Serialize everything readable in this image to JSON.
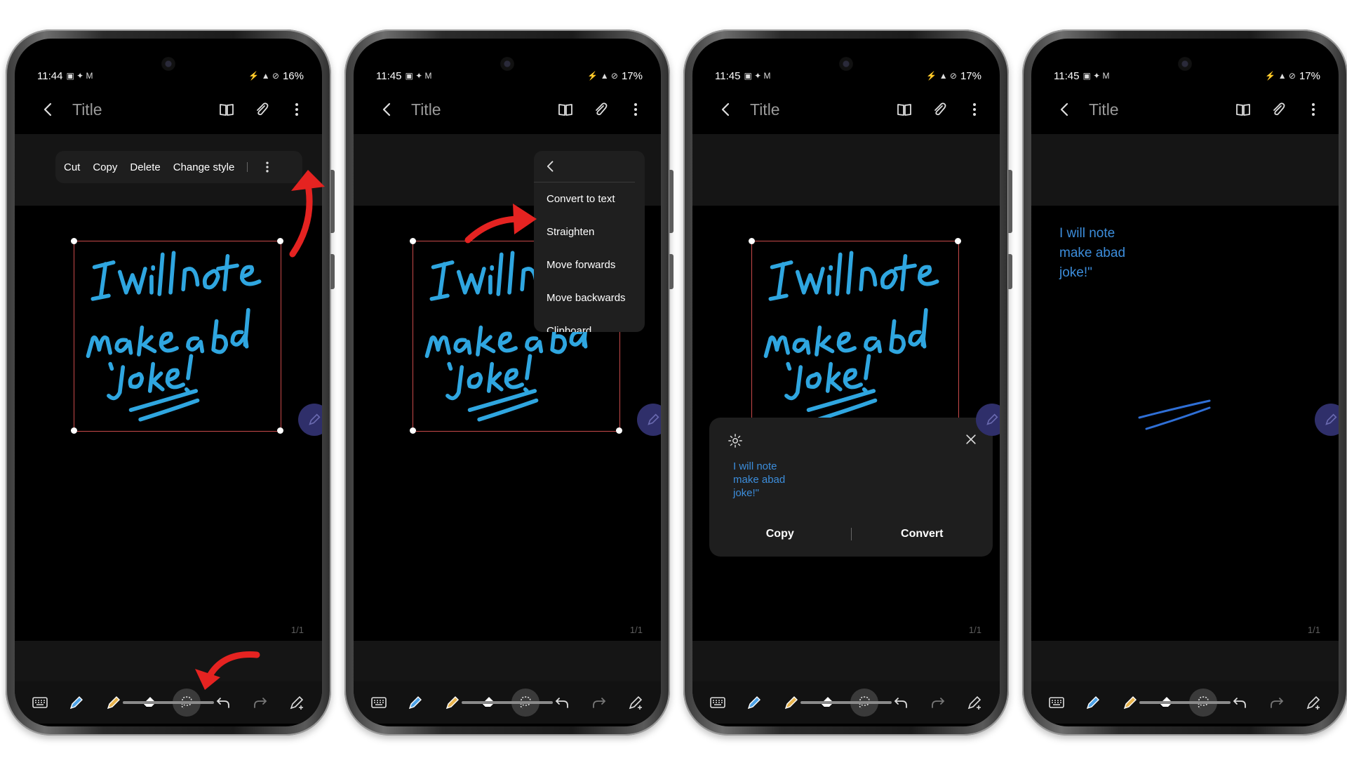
{
  "colors": {
    "ink": "#2fa6e0",
    "text_blue": "#3c8ddb",
    "annotation_red": "#e52321"
  },
  "phones": [
    {
      "id": "step1",
      "status": {
        "time": "11:44",
        "left_icons": "▣ ✦ M",
        "right_icons": "⚡ ▲ ⊘",
        "battery": "16%"
      },
      "appbar": {
        "title": "Title"
      },
      "page_indicator": "1/1",
      "context_bar": {
        "items": [
          "Cut",
          "Copy",
          "Delete",
          "Change style"
        ]
      }
    },
    {
      "id": "step2",
      "status": {
        "time": "11:45",
        "left_icons": "▣ ✦ M",
        "right_icons": "⚡ ▲ ⊘",
        "battery": "17%"
      },
      "appbar": {
        "title": "Title"
      },
      "page_indicator": "1/1",
      "menu": {
        "items": [
          "Convert to text",
          "Straighten",
          "Move forwards",
          "Move backwards",
          "Clipboard"
        ]
      }
    },
    {
      "id": "step3",
      "status": {
        "time": "11:45",
        "left_icons": "▣ ✦ M",
        "right_icons": "⚡ ▲ ⊘",
        "battery": "17%"
      },
      "appbar": {
        "title": "Title"
      },
      "page_indicator": "1/1",
      "dialog": {
        "recognized_text": "I will note\nmake abad\njoke!\"",
        "copy_label": "Copy",
        "convert_label": "Convert"
      }
    },
    {
      "id": "step4",
      "status": {
        "time": "11:45",
        "left_icons": "▣ ✦ M",
        "right_icons": "⚡ ▲ ⊘",
        "battery": "17%"
      },
      "appbar": {
        "title": "Title"
      },
      "page_indicator": "1/1",
      "converted_text": "I will note\nmake abad\njoke!\""
    }
  ],
  "toolbar_tools": [
    "keyboard-icon",
    "pen-icon",
    "highlighter-icon",
    "eraser-icon",
    "lasso-icon",
    "undo-icon",
    "redo-icon",
    "pen-settings-icon"
  ]
}
